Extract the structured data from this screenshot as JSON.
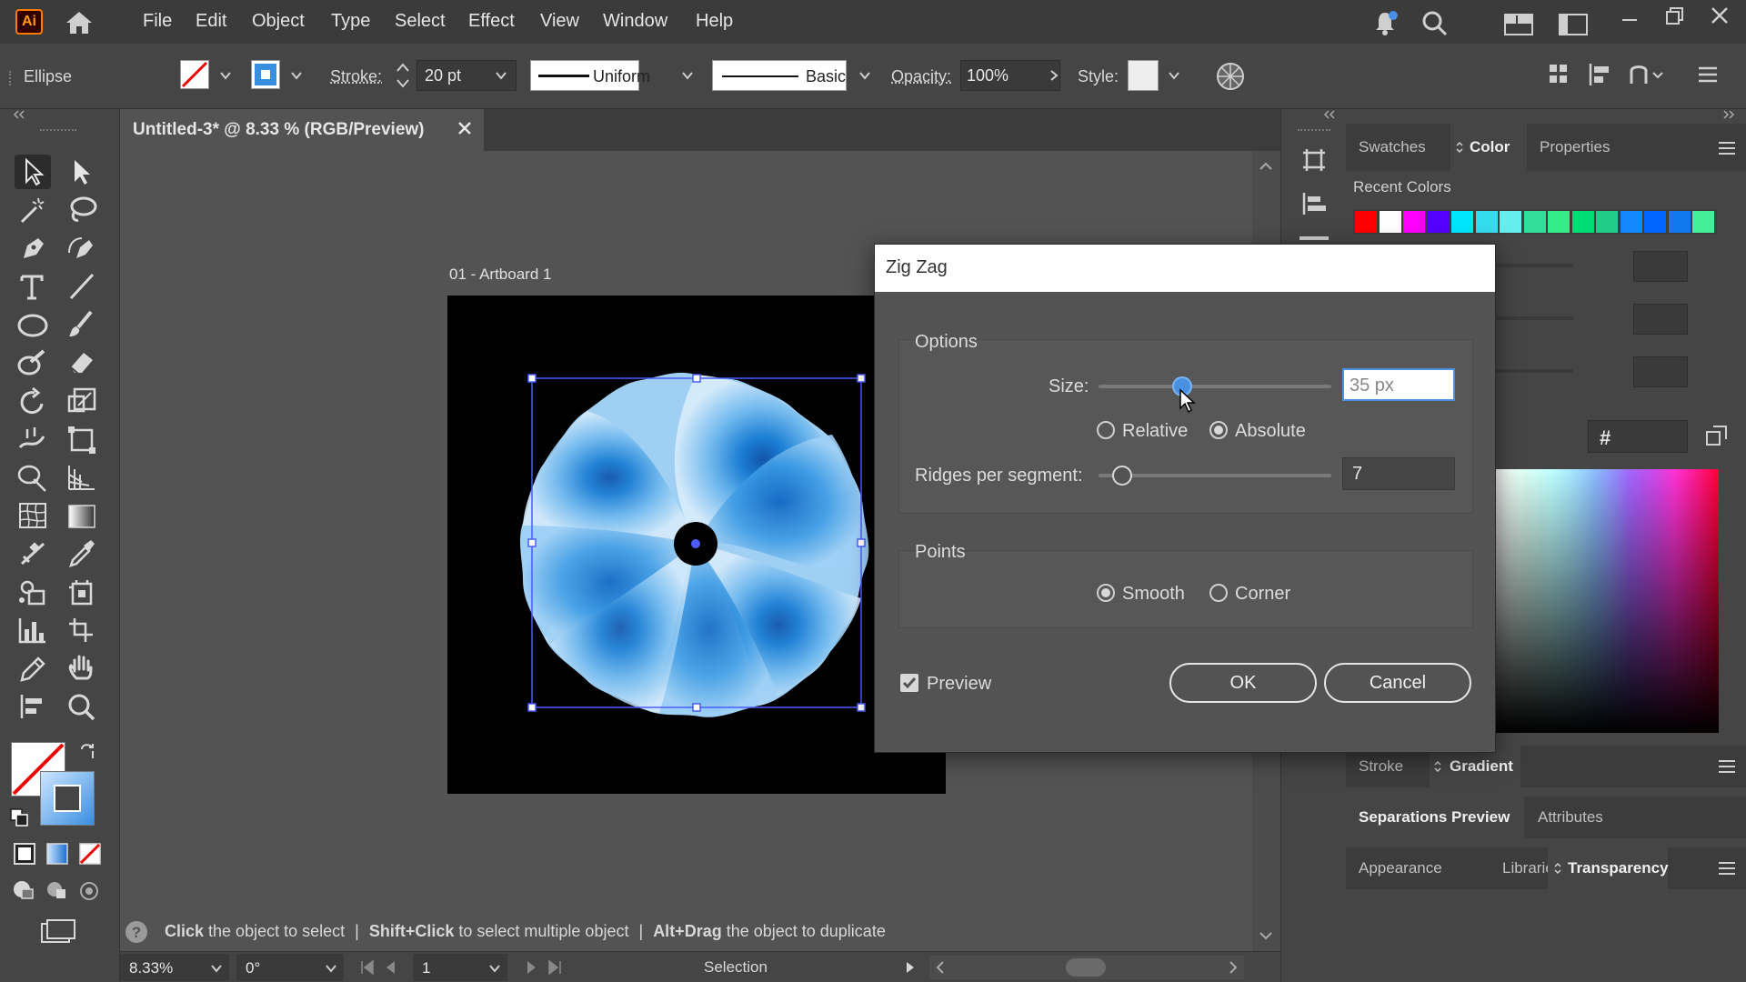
{
  "app": {
    "logo": "Ai"
  },
  "menu": [
    "File",
    "Edit",
    "Object",
    "Type",
    "Select",
    "Effect",
    "View",
    "Window",
    "Help"
  ],
  "control_bar": {
    "object_type": "Ellipse",
    "stroke_label": "Stroke:",
    "stroke_value": "20 pt",
    "profile": "Uniform",
    "brush": "Basic",
    "opacity_label": "Opacity:",
    "opacity_value": "100%",
    "style_label": "Style:"
  },
  "document": {
    "tab_title": "Untitled-3* @ 8.33 % (RGB/Preview)",
    "artboard_label": "01 - Artboard 1"
  },
  "panels": {
    "top_tabs": [
      "Swatches",
      "Color",
      "Properties"
    ],
    "active_top_tab": "Color",
    "recent_colors_label": "Recent Colors",
    "recent_colors": [
      "#ff0000",
      "#ffffff",
      "#ff00ff",
      "#5500ff",
      "#00e6ff",
      "#33ddee",
      "#66eeee",
      "#33dd99",
      "#33ee88",
      "#00dd77",
      "#22cc88",
      "#1188ff",
      "#0066ff",
      "#1177ee",
      "#44ee99"
    ],
    "hex_symbol": "#",
    "mid_tabs": [
      "Stroke",
      "Gradient"
    ],
    "tab_row_2": [
      "Separations Preview",
      "Attributes"
    ],
    "tab_row_3": [
      "Appearance",
      "Libraries",
      "Transparency"
    ]
  },
  "dialog": {
    "title": "Zig Zag",
    "options_label": "Options",
    "size_label": "Size:",
    "size_value": "35 px",
    "size_slider_fraction": 0.36,
    "relative_label": "Relative",
    "absolute_label": "Absolute",
    "mode_selected": "Absolute",
    "ridges_label": "Ridges per segment:",
    "ridges_value": "7",
    "ridges_slider_fraction": 0.1,
    "points_label": "Points",
    "smooth_label": "Smooth",
    "corner_label": "Corner",
    "points_selected": "Smooth",
    "preview_label": "Preview",
    "preview_checked": true,
    "ok_label": "OK",
    "cancel_label": "Cancel"
  },
  "hint": {
    "part1_bold": "Click",
    "part1": " the object to select",
    "sep": "|",
    "part2_bold": "Shift+Click",
    "part2": " to select multiple object",
    "part3_bold": "Alt+Drag",
    "part3": " the object to duplicate"
  },
  "status": {
    "zoom": "8.33%",
    "rotation": "0°",
    "artboard_number": "1",
    "tool": "Selection"
  },
  "colors": {
    "accent": "#4a90e2",
    "selection": "#4a5cff",
    "brand": "#ff9a00"
  }
}
